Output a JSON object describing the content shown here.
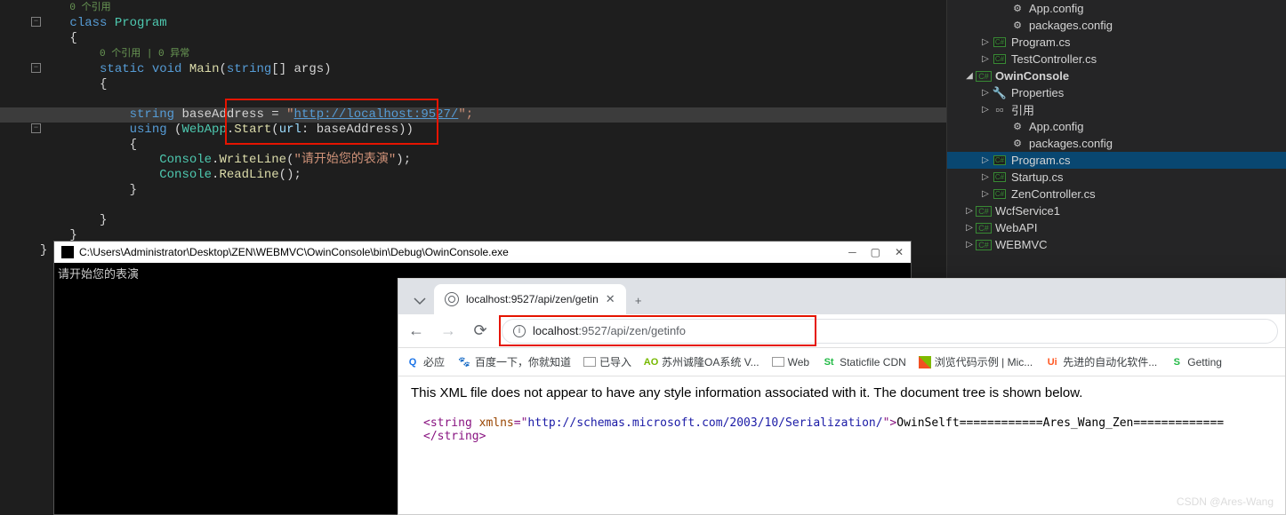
{
  "code": {
    "refs1": "0 个引用",
    "l1_class": "class",
    "l1_name": "Program",
    "brace_open": "{",
    "refs2": "0 个引用 | 0 异常",
    "l2_static": "static",
    "l2_void": "void",
    "l2_main": "Main",
    "l2_paren_open": "(",
    "l2_string": "string",
    "l2_brackets": "[]",
    "l2_args": " args",
    "l2_paren_close": ")",
    "l3": "{",
    "l4_string": "string",
    "l4_var": " baseAddress",
    "l4_eq": " = ",
    "l4_quote": "\"",
    "l4_url": "http://localhost:9527/",
    "l4_end": "\";",
    "l5_using": "using",
    "l5_paren": " (",
    "l5_webapp": "WebApp",
    "l5_dot": ".",
    "l5_start": "Start",
    "l5_open": "(",
    "l5_url": "url",
    "l5_colon": ": baseAddress",
    "l5_close": "))",
    "l6": "{",
    "l7_console": "Console",
    "l7_dot": ".",
    "l7_write": "WriteLine",
    "l7_open": "(",
    "l7_str": "\"请开始您的表演\"",
    "l7_close": ");",
    "l8_console": "Console",
    "l8_dot": ".",
    "l8_read": "ReadLine",
    "l8_parens": "();",
    "l9": "}",
    "l10": "}",
    "l11": "}",
    "l12": "}"
  },
  "solution": {
    "items": [
      {
        "pad": 56,
        "caret": "",
        "icon": "cfg",
        "label": "App.config",
        "interactable": true
      },
      {
        "pad": 56,
        "caret": "",
        "icon": "cfg",
        "label": "packages.config",
        "interactable": true
      },
      {
        "pad": 36,
        "caret": "▷",
        "icon": "cs",
        "label": "Program.cs",
        "interactable": true
      },
      {
        "pad": 36,
        "caret": "▷",
        "icon": "cs",
        "label": "TestController.cs",
        "interactable": true
      },
      {
        "pad": 18,
        "caret": "◢",
        "icon": "proj",
        "label": "OwinConsole",
        "bold": true,
        "interactable": true
      },
      {
        "pad": 36,
        "caret": "▷",
        "icon": "wrench",
        "label": "Properties",
        "interactable": true
      },
      {
        "pad": 36,
        "caret": "▷",
        "icon": "ref",
        "label": "引用",
        "interactable": true
      },
      {
        "pad": 56,
        "caret": "",
        "icon": "cfg",
        "label": "App.config",
        "interactable": true
      },
      {
        "pad": 56,
        "caret": "",
        "icon": "cfg",
        "label": "packages.config",
        "interactable": true
      },
      {
        "pad": 36,
        "caret": "▷",
        "icon": "cs",
        "label": "Program.cs",
        "selected": true,
        "interactable": true
      },
      {
        "pad": 36,
        "caret": "▷",
        "icon": "cs",
        "label": "Startup.cs",
        "interactable": true
      },
      {
        "pad": 36,
        "caret": "▷",
        "icon": "cs",
        "label": "ZenController.cs",
        "interactable": true
      },
      {
        "pad": 18,
        "caret": "▷",
        "icon": "proj",
        "label": "WcfService1",
        "interactable": true
      },
      {
        "pad": 18,
        "caret": "▷",
        "icon": "proj",
        "label": "WebAPI",
        "interactable": true
      },
      {
        "pad": 18,
        "caret": "▷",
        "icon": "proj",
        "label": "WEBMVC",
        "interactable": true
      }
    ]
  },
  "console": {
    "title": "C:\\Users\\Administrator\\Desktop\\ZEN\\WEBMVC\\OwinConsole\\bin\\Debug\\OwinConsole.exe",
    "output": "请开始您的表演"
  },
  "browser": {
    "tab_title": "localhost:9527/api/zen/getin",
    "url_host": "localhost",
    "url_path": ":9527/api/zen/getinfo",
    "bookmarks": [
      {
        "color": "#1a73e8",
        "icon": "Q",
        "label": "必应"
      },
      {
        "color": "#2932e1",
        "icon": "🐾",
        "label": "百度一下，你就知道"
      },
      {
        "color": "#6d6d6d",
        "icon": "▭",
        "label": "已导入"
      },
      {
        "color": "#76b900",
        "icon": "AO",
        "label": "苏州诚隆OA系统 V..."
      },
      {
        "color": "#6d6d6d",
        "icon": "▭",
        "label": "Web"
      },
      {
        "color": "#21ba45",
        "icon": "St",
        "label": "Staticfile CDN"
      },
      {
        "color": "",
        "icon": "ms",
        "label": "浏览代码示例 | Mic..."
      },
      {
        "color": "#ff5722",
        "icon": "Ui",
        "label": "先进的自动化软件..."
      },
      {
        "color": "#21ba45",
        "icon": "S",
        "label": "Getting"
      }
    ],
    "xml_notice": "This XML file does not appear to have any style information associated with it. The document tree is shown below.",
    "xml": {
      "open_tag": "<string",
      "attr_name": " xmlns",
      "eq": "=\"",
      "attr_val": "http://schemas.microsoft.com/2003/10/Serialization/",
      "close_q": "\">",
      "content": "OwinSelft============Ares_Wang_Zen=============",
      "close_tag": "</string>"
    }
  },
  "watermark": "CSDN @Ares-Wang"
}
